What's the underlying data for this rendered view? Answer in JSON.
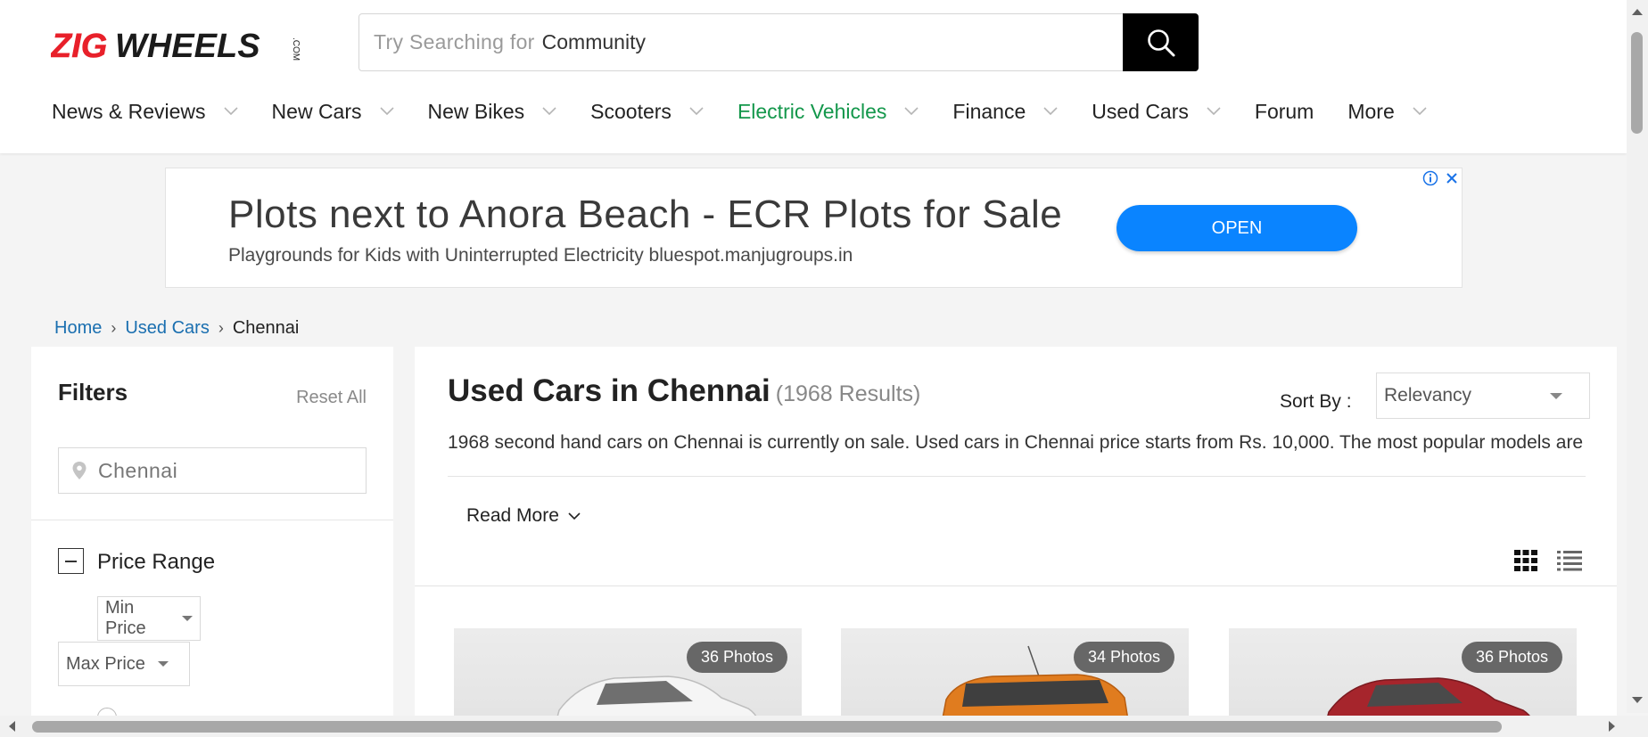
{
  "header": {
    "logo_text": "ZIGWHEELS",
    "logo_suffix": ".COM",
    "search": {
      "placeholder": "Try Searching for",
      "value": "Community"
    }
  },
  "nav": [
    {
      "label": "News & Reviews",
      "dropdown": true
    },
    {
      "label": "New Cars",
      "dropdown": true
    },
    {
      "label": "New Bikes",
      "dropdown": true
    },
    {
      "label": "Scooters",
      "dropdown": true
    },
    {
      "label": "Electric Vehicles",
      "dropdown": true,
      "color": "#13974b"
    },
    {
      "label": "Finance",
      "dropdown": true
    },
    {
      "label": "Used Cars",
      "dropdown": true
    },
    {
      "label": "Forum",
      "dropdown": false
    },
    {
      "label": "More",
      "dropdown": true
    }
  ],
  "ad": {
    "title": "Plots next to Anora Beach - ECR Plots for Sale",
    "subtitle": "Playgrounds for Kids with Uninterrupted Electricity bluespot.manjugroups.in",
    "cta": "OPEN",
    "cta_color": "#0a84ff"
  },
  "breadcrumb": {
    "home": "Home",
    "used_cars": "Used Cars",
    "current": "Chennai"
  },
  "filters": {
    "title": "Filters",
    "reset": "Reset All",
    "city": "Chennai",
    "price_range": "Price Range",
    "min_price": "Min Price",
    "max_price": "Max Price"
  },
  "main": {
    "title": "Used Cars in Chennai",
    "count": "(1968 Results)",
    "sort_label": "Sort By :",
    "sort_value": "Relevancy",
    "description": "1968 second hand cars on Chennai is currently on sale. Used cars in Chennai price starts from Rs. 10,000. The most popular models are",
    "read_more": "Read More"
  },
  "cards": [
    {
      "photos": "36 Photos",
      "car_color": "#f2f2f2"
    },
    {
      "photos": "34 Photos",
      "car_color": "#e07c1f"
    },
    {
      "photos": "36 Photos",
      "car_color": "#a6252c"
    }
  ],
  "colors": {
    "accent_green": "#13974b",
    "link_blue": "#1a6fb0",
    "brand_red": "#e8202a"
  }
}
